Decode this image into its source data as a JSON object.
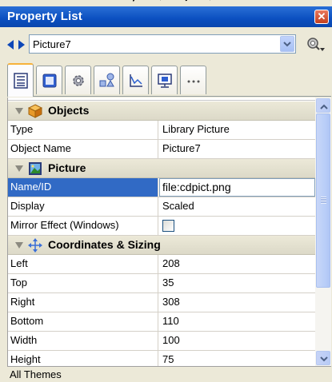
{
  "window": {
    "title": "Property List"
  },
  "selector": {
    "value": "Picture7"
  },
  "tabs": [
    {
      "icon": "list-icon",
      "active": true
    },
    {
      "icon": "card-icon",
      "active": false
    },
    {
      "icon": "gear-icon",
      "active": false
    },
    {
      "icon": "shapes-icon",
      "active": false
    },
    {
      "icon": "chart-icon",
      "active": false
    },
    {
      "icon": "monitor-icon",
      "active": false
    },
    {
      "icon": "more-icon",
      "active": false
    }
  ],
  "sections": {
    "objects": {
      "label": "Objects",
      "rows": [
        {
          "name": "Type",
          "value": "Library Picture"
        },
        {
          "name": "Object Name",
          "value": "Picture7"
        }
      ]
    },
    "picture": {
      "label": "Picture",
      "rows": [
        {
          "name": "Name/ID",
          "value": "file:cdpict.png"
        },
        {
          "name": "Display",
          "value": "Scaled"
        },
        {
          "name": "Mirror Effect (Windows)",
          "value": ""
        }
      ]
    },
    "coordinates": {
      "label": "Coordinates & Sizing",
      "rows": [
        {
          "name": "Left",
          "value": "208"
        },
        {
          "name": "Top",
          "value": "35"
        },
        {
          "name": "Right",
          "value": "308"
        },
        {
          "name": "Bottom",
          "value": "110"
        },
        {
          "name": "Width",
          "value": "100"
        },
        {
          "name": "Height",
          "value": "75"
        }
      ]
    }
  },
  "status": {
    "label": "All Themes"
  },
  "colors": {
    "titlebar": "#0b4fc0",
    "selection": "#316ac5",
    "panel": "#ece9d8"
  }
}
